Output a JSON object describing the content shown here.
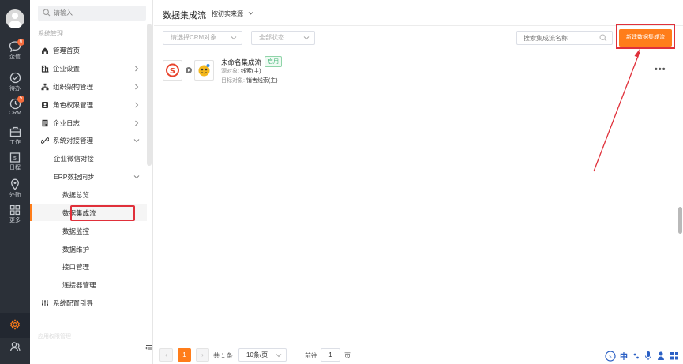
{
  "rail": {
    "items": [
      {
        "label": "企信",
        "badge": "6",
        "icon": "chat-icon"
      },
      {
        "label": "待办",
        "badge": "",
        "icon": "check-circle-icon"
      },
      {
        "label": "CRM",
        "badge": "5",
        "icon": "crm-icon"
      },
      {
        "label": "工作",
        "badge": "",
        "icon": "briefcase-icon"
      },
      {
        "label": "日程",
        "badge": "",
        "icon": "calendar-icon"
      },
      {
        "label": "外勤",
        "badge": "",
        "icon": "location-icon"
      },
      {
        "label": "更多",
        "badge": "",
        "icon": "grid-icon"
      }
    ],
    "bottom_icons": [
      "settings-icon",
      "contacts-icon"
    ]
  },
  "sidebar": {
    "search_placeholder": "请输入",
    "section_title": "系统管理",
    "menu": [
      {
        "label": "管理首页",
        "icon": "home-icon",
        "arrow": false
      },
      {
        "label": "企业设置",
        "icon": "building-icon",
        "arrow": "right"
      },
      {
        "label": "组织架构管理",
        "icon": "org-icon",
        "arrow": "right"
      },
      {
        "label": "角色权限管理",
        "icon": "user-lock-icon",
        "arrow": "right"
      },
      {
        "label": "企业日志",
        "icon": "log-icon",
        "arrow": "right"
      },
      {
        "label": "系统对接管理",
        "icon": "link-icon",
        "arrow": "down"
      }
    ],
    "sub_l1": [
      "企业微信对接",
      "ERP数据同步"
    ],
    "sub_l2": [
      "数据总览",
      "数据集成流",
      "数据监控",
      "数据维护",
      "接口管理",
      "连接器管理"
    ],
    "guide": {
      "label": "系统配置引导",
      "icon": "sliders-icon"
    },
    "faded_text": "应用权限管理"
  },
  "main": {
    "title": "数据集成流",
    "title_sub": "按初实来源",
    "filter_crm_placeholder": "请选择CRM对象",
    "filter_status_placeholder": "全部状态",
    "search_placeholder": "搜索集成流名称",
    "new_button": "新建数据集成流",
    "flow": {
      "name": "未命名集成流",
      "status": "启用",
      "source_label": "源对象:",
      "source_value": "线索(主)",
      "target_label": "目标对象:",
      "target_value": "销售线索(主)",
      "more": "•••"
    }
  },
  "pagination": {
    "prev": "‹",
    "current": "1",
    "next": "›",
    "total": "共 1 条",
    "page_size": "10条/页",
    "goto_label": "前往",
    "goto_value": "1",
    "page_unit": "页"
  },
  "ime": {
    "lang": "中"
  },
  "colors": {
    "accent": "#ff7d1a",
    "annotation": "#e0303a",
    "rail_bg": "#2b3038",
    "status_green": "#3cb371"
  }
}
